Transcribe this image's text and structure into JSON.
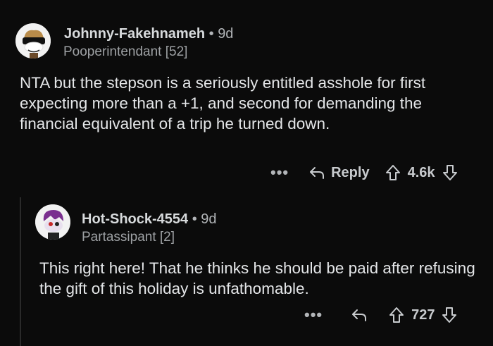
{
  "comments": [
    {
      "username": "Johnny-Fakehnameh",
      "age": "9d",
      "flair": "Pooperintendant [52]",
      "body": "NTA but the stepson is a seriously entitled asshole for first expecting more than a +1, and second for demanding the financial equivalent of a trip he turned down.",
      "actions": {
        "more": "•••",
        "reply_label": "Reply",
        "score": "4.6k"
      }
    },
    {
      "username": "Hot-Shock-4554",
      "age": "9d",
      "flair": "Partassipant [2]",
      "body": "This right here! That he thinks he should be paid after refusing the gift of this holiday is unfathomable.",
      "actions": {
        "more": "•••",
        "score": "727"
      }
    }
  ],
  "separator": "•",
  "colors": {
    "background": "#000000",
    "text": "#d7dadc",
    "muted": "#9ea1a4"
  },
  "icons": [
    "reply-icon",
    "upvote-icon",
    "downvote-icon",
    "more-icon"
  ]
}
